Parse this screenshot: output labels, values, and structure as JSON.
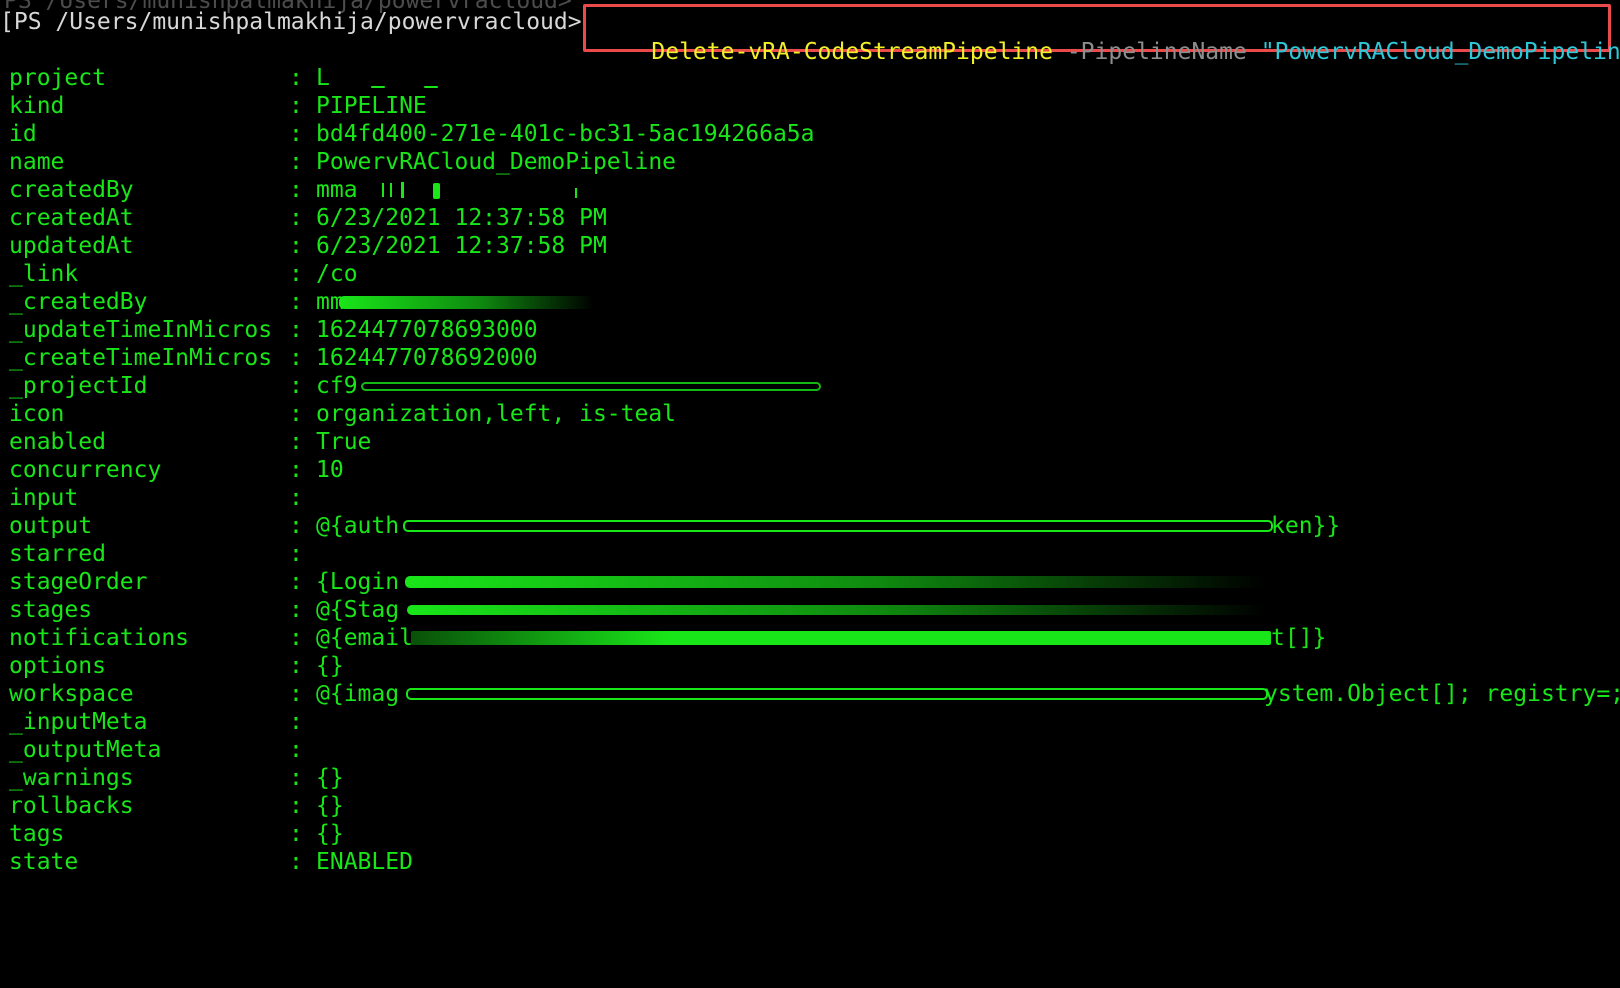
{
  "terminal": {
    "previous_line": "PS /Users/munishpalmakhija/powervracloud>",
    "prompt": "[PS /Users/munishpalmakhija/powervracloud>",
    "command": {
      "cmdlet": "Delete-vRA-CodeStreamPipeline",
      "param": "-PipelineName",
      "value": "\"PowervRACloud_DemoPipeline\""
    },
    "colors": {
      "output_text": "#19e619",
      "cmdlet": "#f2ef2a",
      "param": "#8d8d8d",
      "string": "#2ec8d8",
      "highlight_border": "#ea4a4a",
      "background": "#000000"
    }
  },
  "output": {
    "separator": ":",
    "rows": [
      {
        "key": "project",
        "value": "L"
      },
      {
        "key": "kind",
        "value": "PIPELINE"
      },
      {
        "key": "id",
        "value": "bd4fd400-271e-401c-bc31-5ac194266a5a"
      },
      {
        "key": "name",
        "value": "PowervRACloud_DemoPipeline"
      },
      {
        "key": "createdBy",
        "value": "mma"
      },
      {
        "key": "createdAt",
        "value": "6/23/2021 12:37:58 PM"
      },
      {
        "key": "updatedAt",
        "value": "6/23/2021 12:37:58 PM"
      },
      {
        "key": "_link",
        "value": "/co"
      },
      {
        "key": "_createdBy",
        "value": "mm"
      },
      {
        "key": "_updateTimeInMicros",
        "value": "1624477078693000"
      },
      {
        "key": "_createTimeInMicros",
        "value": "1624477078692000"
      },
      {
        "key": "_projectId",
        "value": "cf9"
      },
      {
        "key": "icon",
        "value": "organization,left, is-teal"
      },
      {
        "key": "enabled",
        "value": "True"
      },
      {
        "key": "concurrency",
        "value": "10"
      },
      {
        "key": "input",
        "value": ""
      },
      {
        "key": "output",
        "value": "@{auth",
        "tail": "ken}}"
      },
      {
        "key": "starred",
        "value": ""
      },
      {
        "key": "stageOrder",
        "value": "{Login"
      },
      {
        "key": "stages",
        "value": "@{Stag"
      },
      {
        "key": "notifications",
        "value": "@{email",
        "tail": "t[]}"
      },
      {
        "key": "options",
        "value": "{}"
      },
      {
        "key": "workspace",
        "value": "@{imag",
        "tail": "ystem.Object[]; registry=;"
      },
      {
        "key": "_inputMeta",
        "value": ""
      },
      {
        "key": "_outputMeta",
        "value": ""
      },
      {
        "key": "_warnings",
        "value": "{}"
      },
      {
        "key": "rollbacks",
        "value": "{}"
      },
      {
        "key": "tags",
        "value": "{}"
      },
      {
        "key": "state",
        "value": "ENABLED"
      }
    ]
  }
}
